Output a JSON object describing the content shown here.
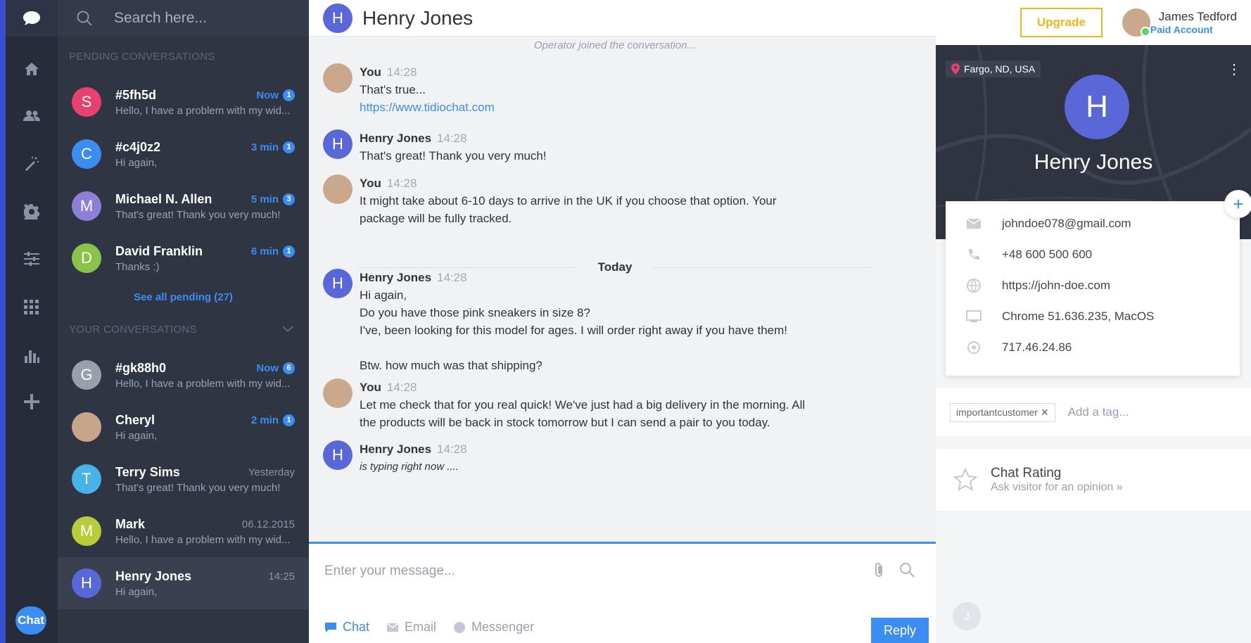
{
  "search": {
    "placeholder": "Search here..."
  },
  "sections": {
    "pending": "PENDING CONVERSATIONS",
    "yours": "YOUR CONVERSATIONS",
    "see_all": "See all pending (27)"
  },
  "pending": [
    {
      "initial": "S",
      "color": "#e8416f",
      "name": "#5fh5d",
      "time": "Now",
      "count": "1",
      "preview": "Hello, I have a problem with my wid..."
    },
    {
      "initial": "C",
      "color": "#3b8df2",
      "name": "#c4j0z2",
      "time": "3 min",
      "count": "1",
      "preview": "Hi again,"
    },
    {
      "initial": "M",
      "color": "#8e7fd6",
      "name": "Michael N. Allen",
      "time": "5 min",
      "count": "3",
      "preview": "That's great! Thank you very much!"
    },
    {
      "initial": "D",
      "color": "#8bc34a",
      "name": "David Franklin",
      "time": "6 min",
      "count": "1",
      "preview": "Thanks :)"
    }
  ],
  "yours": [
    {
      "initial": "G",
      "color": "#9aa0ab",
      "name": "#gk88h0",
      "time": "Now",
      "count": "6",
      "preview": "Hello, I have a problem with my wid..."
    },
    {
      "initial": "",
      "color": "#c7a58a",
      "name": "Cheryl",
      "time": "2 min",
      "count": "1",
      "preview": "Hi again,"
    },
    {
      "initial": "T",
      "color": "#48b3e8",
      "name": "Terry Sims",
      "time": "Yesterday",
      "count": "",
      "preview": "That's great! Thank you very much!"
    },
    {
      "initial": "M",
      "color": "#b8cc3a",
      "name": "Mark",
      "time": "06.12.2015",
      "count": "",
      "preview": "Hello, I have a problem with my wid..."
    },
    {
      "initial": "H",
      "color": "#5a67d8",
      "name": "Henry Jones",
      "time": "14:25",
      "count": "",
      "preview": "Hi again,"
    }
  ],
  "chat": {
    "title": "Henry Jones",
    "avatar_initial": "H",
    "system": "Operator joined the conversation...",
    "today": "Today",
    "messages": [
      {
        "name": "You",
        "time": "14:28",
        "lines": [
          "That's true..."
        ],
        "link": "https://www.tidiochat.com"
      },
      {
        "name": "Henry Jones",
        "time": "14:28",
        "lines": [
          "That's great! Thank you very much!"
        ]
      },
      {
        "name": "You",
        "time": "14:28",
        "lines": [
          "It might take about 6-10 days to arrive in the UK if you choose that option. Your",
          "package will be fully tracked."
        ]
      },
      {
        "name": "Henry Jones",
        "time": "14:28",
        "lines": [
          "Hi again,",
          "Do you have those pink sneakers in size 8?",
          "I've, been looking for this model for ages. I will order right away if you have them!",
          "",
          "Btw. how much was that shipping?"
        ]
      },
      {
        "name": "You",
        "time": "14:28",
        "lines": [
          "Let me check that for you real quick! We've just had a big delivery in the morning. All",
          "the products will be back in stock tomorrow but I can send a pair to you today."
        ]
      },
      {
        "name": "Henry Jones",
        "time": "14:28",
        "lines": [
          "is typing right now ...."
        ]
      }
    ],
    "composer_placeholder": "Enter your message...",
    "channels": [
      "Chat",
      "Email",
      "Messenger"
    ],
    "reply": "Reply",
    "rail_badge": "Chat"
  },
  "topbar": {
    "upgrade": "Upgrade",
    "user_name": "James Tedford",
    "user_status": "Paid Account"
  },
  "visitor": {
    "location": "Fargo, ND, USA",
    "initial": "H",
    "name": "Henry Jones",
    "email": "johndoe078@gmail.com",
    "phone": "+48 600 500 600",
    "website": "https://john-doe.com",
    "browser": "Chrome 51.636.235, MacOS",
    "ip": "717.46.24.86",
    "tag": "importantcustomer",
    "add_tag": "Add a tag...",
    "rating_title": "Chat Rating",
    "rating_sub": "Ask visitor for an opinion »",
    "bottom_badge": "J"
  }
}
